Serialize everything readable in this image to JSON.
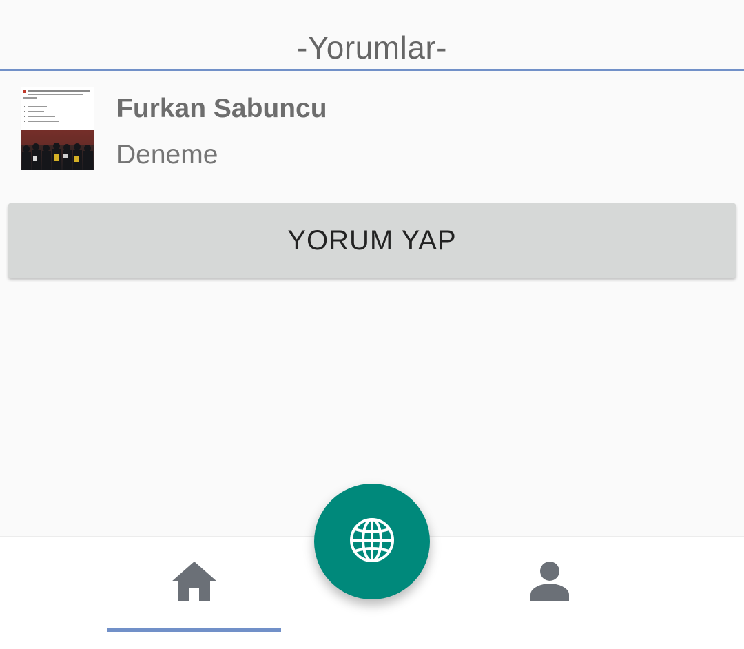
{
  "header": {
    "title": "-Yorumlar-"
  },
  "comments": [
    {
      "author": "Furkan Sabuncu",
      "text": "Deneme",
      "avatar_icon": "post-thumbnail-image"
    }
  ],
  "actions": {
    "comment_button_label": "YORUM YAP"
  },
  "bottom_nav": {
    "items": [
      {
        "icon": "home-icon",
        "active": true
      },
      {
        "icon": "person-icon",
        "active": false
      }
    ],
    "fab_icon": "globe-icon"
  },
  "colors": {
    "accent": "#7190c8",
    "fab": "#00897b",
    "nav_icon": "#6b7077",
    "button_bg": "#d6d8d7",
    "background": "#fafafa"
  }
}
